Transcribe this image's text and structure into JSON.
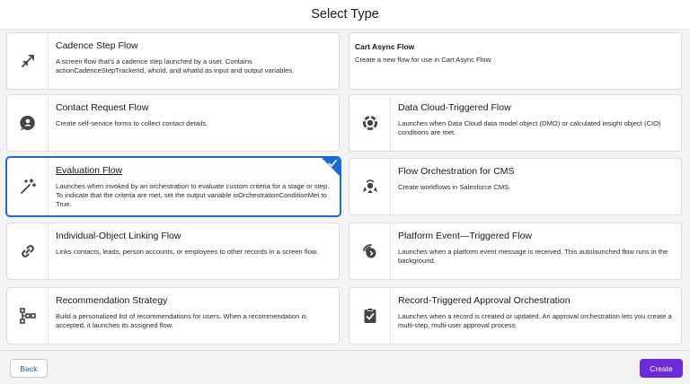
{
  "header": {
    "title": "Select Type"
  },
  "cards": [
    {
      "title": "Cadence Step Flow",
      "desc": "A screen flow that's a cadence step launched by a user. Contains actionCadenceStepTrackerId, whoId, and whatId as input and output variables.",
      "icon": "cadence-arrows-icon"
    },
    {
      "title": "Cart Async Flow",
      "desc": "Create a new flow for use in Cart Async Flow."
    },
    {
      "title": "Contact Request Flow",
      "desc": "Create self-service forms to collect contact details.",
      "icon": "contact-request-icon"
    },
    {
      "title": "Data Cloud-Triggered Flow",
      "desc": "Launches when Data Cloud data model object (DMO) or calculated insight object (CIO) conditions are met.",
      "icon": "data-cloud-icon"
    },
    {
      "title": "Evaluation Flow",
      "desc": "Launches when invoked by an orchestration to evaluate custom criteria for a stage or step. To indicate that the criteria are met, set the output variable isOrchestrationConditionMet to True.",
      "icon": "magic-wand-icon",
      "selected": true
    },
    {
      "title": "Flow Orchestration for CMS",
      "desc": "Create workflows in Salesforce CMS.",
      "icon": "cms-orchestration-icon"
    },
    {
      "title": "Individual-Object Linking Flow",
      "desc": "Links contacts, leads, person accounts, or employees to other records in a screen flow.",
      "icon": "link-icon"
    },
    {
      "title": "Platform Event—Triggered Flow",
      "desc": "Launches when a platform event message is received. This autolaunched flow runs in the background.",
      "icon": "platform-event-icon"
    },
    {
      "title": "Recommendation Strategy",
      "desc": "Build a personalized list of recommendations for users. When a recommendation is accepted, it launches its assigned flow.",
      "icon": "strategy-icon"
    },
    {
      "title": "Record-Triggered Approval Orchestration",
      "desc": "Launches when a record is created or updated. An approval orchestration lets you create a multi-step, multi-user approval process.",
      "icon": "approval-clipboard-icon"
    }
  ],
  "footer": {
    "back_label": "Back",
    "create_label": "Create"
  },
  "colors": {
    "accent": "#1b6bd6",
    "create": "#6b2bd8",
    "link": "#0b5cab"
  }
}
